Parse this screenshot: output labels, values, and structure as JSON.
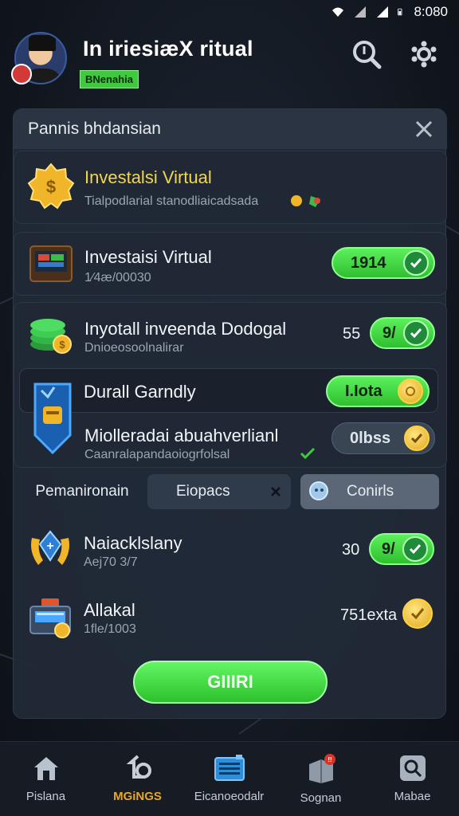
{
  "status_bar": {
    "time": "8:080"
  },
  "header": {
    "title": "In iriesiæX ritual",
    "badge": "BNenahia"
  },
  "panel": {
    "title": "Pannis bhdansian",
    "cards": [
      {
        "title": "Investalsi Virtual",
        "subtitle": "Tialpodlarial stanodliaicadsada"
      },
      {
        "title": "Investaisi Virtual",
        "subtitle": "1⁄4æ/00030",
        "pill": "1914"
      },
      {
        "title": "Inyotall inveenda Dodogal",
        "subtitle": "Dnioeosoolnalirar",
        "number": "55",
        "pill": "9/"
      },
      {
        "title": "Durall Garndly",
        "pill": "I.Iota"
      },
      {
        "title": "Miolleradai abuahverlianl",
        "subtitle": "Caanralapandaoiogrfolsal",
        "pill": "0lbss"
      }
    ],
    "tabs": [
      {
        "label": "Pemanironain"
      },
      {
        "label": "Eiopacs"
      },
      {
        "label": "Conirls"
      }
    ],
    "list": [
      {
        "title": "Naiacklslany",
        "subtitle": "Aej70 3/7",
        "number": "30",
        "pill": "9/"
      },
      {
        "title": "Allakal",
        "subtitle": "1fle/1003",
        "number": "751exta"
      }
    ],
    "go_button": "GIIIRI"
  },
  "bottom_nav": [
    {
      "label": "Pislana",
      "icon": "home-icon"
    },
    {
      "label": "MGiNGS",
      "icon": "refresh-icon",
      "active": true
    },
    {
      "label": "Eicanoeodalr",
      "icon": "document-icon"
    },
    {
      "label": "Sognan",
      "icon": "gift-box-icon"
    },
    {
      "label": "Mabae",
      "icon": "search-icon"
    }
  ],
  "colors": {
    "accent_green": "#3ec93e",
    "gold": "#f3d64b",
    "active_nav": "#e8a62c"
  }
}
